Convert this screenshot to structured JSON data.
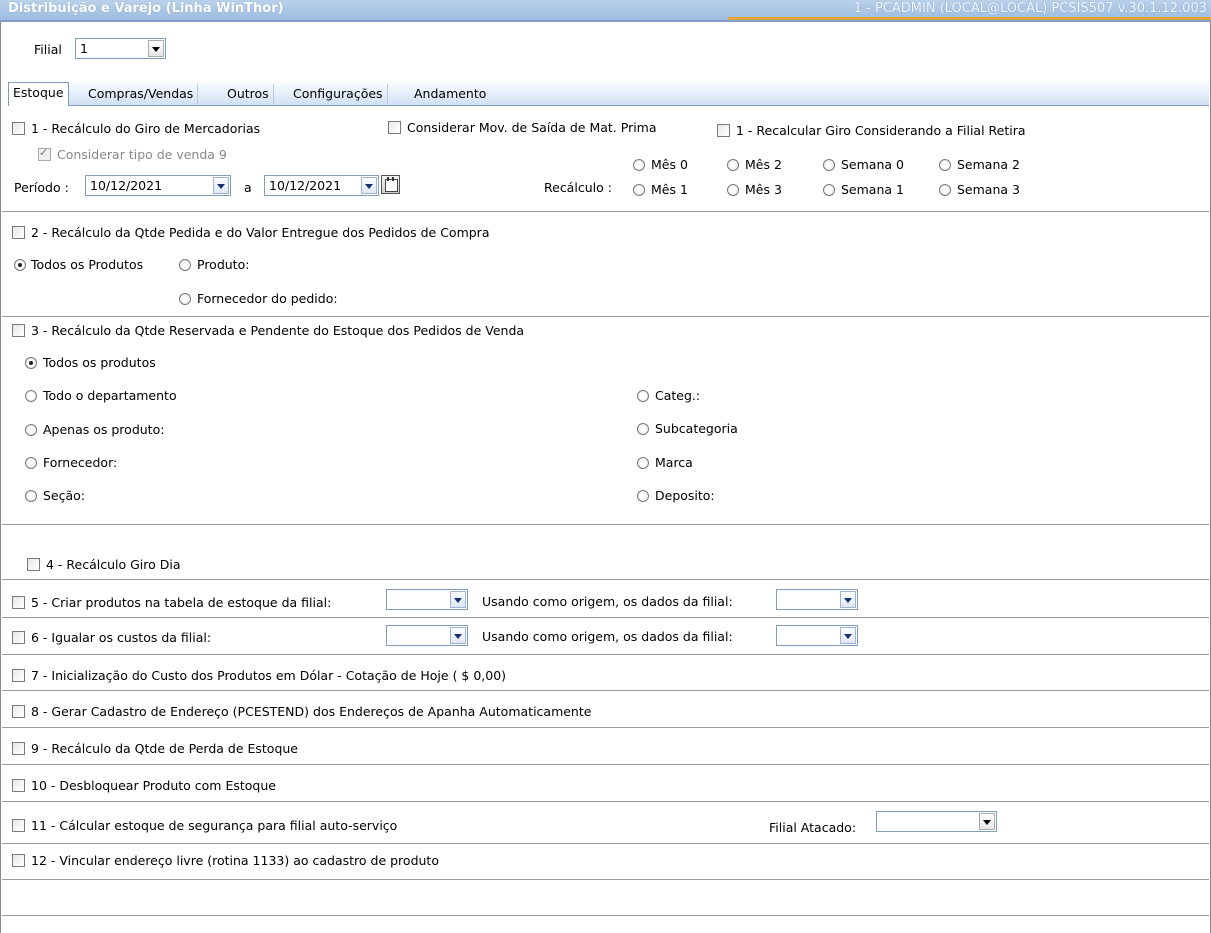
{
  "window": {
    "title": "Distribuição e Varejo (Linha WinThor)",
    "status": "1 - PCADMIN (LOCAL@LOCAL)   PCSIS507  v.30.1.12.003"
  },
  "filial": {
    "label": "Filial",
    "value": "1"
  },
  "tabs": [
    "Estoque",
    "Compras/Vendas",
    "Outros",
    "Configurações",
    "Andamento"
  ],
  "opt1": {
    "label": "1 - Recálculo do Giro de Mercadorias",
    "considerar_tipo": "Considerar tipo de venda 9",
    "considerar_mov": "Considerar Mov. de Saída de Mat. Prima",
    "recalcular_filial": "1 - Recalcular Giro Considerando a Filial Retira",
    "periodo_label": "Período :",
    "data_inicio": "10/12/2021",
    "a_label": "a",
    "data_fim": "10/12/2021",
    "recalculo_label": "Recálculo :",
    "radios": [
      "Mês 0",
      "Mês 2",
      "Semana 0",
      "Semana 2",
      "Mês 1",
      "Mês 3",
      "Semana 1",
      "Semana 3"
    ]
  },
  "opt2": {
    "label": "2 - Recálculo da Qtde Pedida e do Valor Entregue dos Pedidos de Compra",
    "todos": "Todos os Produtos",
    "produto": "Produto:",
    "fornecedor": "Fornecedor do pedido:"
  },
  "opt3": {
    "label": "3 - Recálculo da Qtde Reservada e Pendente do Estoque dos Pedidos de Venda",
    "left": [
      "Todos os produtos",
      "Todo o departamento",
      "Apenas os produto:",
      "Fornecedor:",
      "Seção:"
    ],
    "right": [
      "Categ.:",
      "Subcategoria",
      "Marca",
      "Deposito:"
    ]
  },
  "opt4": {
    "label": "4 - Recálculo Giro Dia"
  },
  "opt5": {
    "label": "5 - Criar produtos na tabela de estoque da filial:",
    "origem": "Usando como origem, os dados da filial:"
  },
  "opt6": {
    "label": "6 - Igualar os custos da filial:",
    "origem": "Usando como origem, os dados da filial:"
  },
  "opt7": {
    "label": "7 - Inicialização do Custo dos Produtos em Dólar - Cotação de Hoje ( $ 0,00)"
  },
  "opt8": {
    "label": "8 - Gerar Cadastro de Endereço (PCESTEND) dos Endereços de Apanha Automaticamente"
  },
  "opt9": {
    "label": "9 - Recálculo da Qtde de Perda de Estoque"
  },
  "opt10": {
    "label": "10 - Desbloquear Produto com Estoque"
  },
  "opt11": {
    "label": "11 - Cálcular estoque de segurança para filial auto-serviço",
    "filial_atacado": "Filial Atacado:"
  },
  "opt12": {
    "label": "12 - Vincular endereço livre (rotina 1133) ao cadastro de produto"
  }
}
